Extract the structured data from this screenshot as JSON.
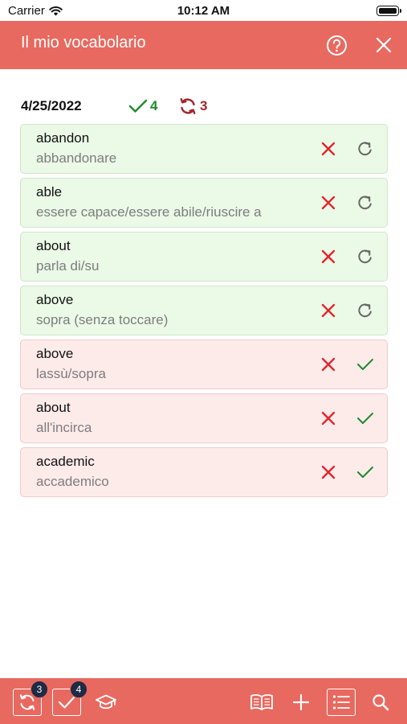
{
  "status_bar": {
    "carrier": "Carrier",
    "time": "10:12 AM"
  },
  "header": {
    "title": "Il mio vocabolario"
  },
  "summary": {
    "date": "4/25/2022",
    "known_count": "4",
    "repeat_count": "3"
  },
  "words": [
    {
      "term": "abandon",
      "translation": "abbandonare",
      "state": "known"
    },
    {
      "term": "able",
      "translation": "essere capace/essere abile/riuscire a",
      "state": "known"
    },
    {
      "term": "about",
      "translation": "parla di/su",
      "state": "known"
    },
    {
      "term": "above",
      "translation": "sopra (senza toccare)",
      "state": "known"
    },
    {
      "term": "above",
      "translation": "lassù/sopra",
      "state": "repeat"
    },
    {
      "term": "about",
      "translation": "all'incirca",
      "state": "repeat"
    },
    {
      "term": "academic",
      "translation": "accademico",
      "state": "repeat"
    }
  ],
  "tab_bar": {
    "repeat_badge": "3",
    "known_badge": "4"
  },
  "colors": {
    "accent": "#e8695f",
    "known_green": "#1f8a2e",
    "repeat_red": "#a3252c",
    "delete_red": "#e2232b"
  },
  "icons": [
    "wifi-icon",
    "battery-icon",
    "help-icon",
    "close-icon",
    "checkmark-icon",
    "refresh-icon",
    "delete-x-icon",
    "graduation-cap-icon",
    "book-icon",
    "plus-icon",
    "list-icon",
    "search-icon"
  ]
}
